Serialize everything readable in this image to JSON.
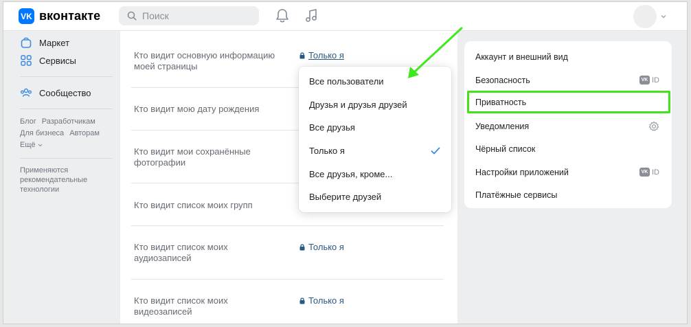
{
  "header": {
    "logo_mark": "VK",
    "logo_text": "вконтакте",
    "search_placeholder": "Поиск"
  },
  "left_nav": {
    "items": [
      {
        "label": "Маркет",
        "icon": "bag-icon"
      },
      {
        "label": "Сервисы",
        "icon": "grid-icon"
      },
      {
        "label": "Сообщество",
        "icon": "community-icon"
      }
    ],
    "footer_links": [
      "Блог",
      "Разработчикам",
      "Для бизнеса",
      "Авторам",
      "Ещё"
    ],
    "recommendation_text_1": "Применяются",
    "recommendation_text_2": "рекомендательные",
    "recommendation_text_3": "технологии"
  },
  "privacy_rows": [
    {
      "label_1": "Кто видит основную информацию",
      "label_2": "моей страницы",
      "value": "Только я"
    },
    {
      "label_1": "Кто видит мою дату рождения",
      "label_2": "",
      "value": ""
    },
    {
      "label_1": "Кто видит мои сохранённые",
      "label_2": "фотографии",
      "value": ""
    },
    {
      "label_1": "Кто видит список моих групп",
      "label_2": "",
      "value": ""
    },
    {
      "label_1": "Кто видит список моих",
      "label_2": "аудиозаписей",
      "value": "Только я"
    },
    {
      "label_1": "Кто видит список моих",
      "label_2": "видеозаписей",
      "value": "Только я"
    }
  ],
  "dropdown": {
    "options": [
      "Все пользователи",
      "Друзья и друзья друзей",
      "Все друзья",
      "Только я",
      "Все друзья, кроме...",
      "Выберите друзей"
    ],
    "selected": "Только я"
  },
  "settings_menu": {
    "items": [
      {
        "label": "Аккаунт и внешний вид",
        "badge": ""
      },
      {
        "label": "Безопасность",
        "badge": "ID"
      },
      {
        "label": "Приватность",
        "badge": ""
      },
      {
        "label": "Уведомления",
        "badge": ""
      },
      {
        "label": "Чёрный список",
        "badge": ""
      },
      {
        "label": "Настройки приложений",
        "badge": "ID"
      },
      {
        "label": "Платёжные сервисы",
        "badge": ""
      }
    ],
    "highlighted": "Приватность",
    "vk_badge": "VK"
  },
  "colors": {
    "accent": "#0077ff",
    "link": "#2a5885",
    "highlight": "#43e21c",
    "arrow": "#3fe81c"
  }
}
